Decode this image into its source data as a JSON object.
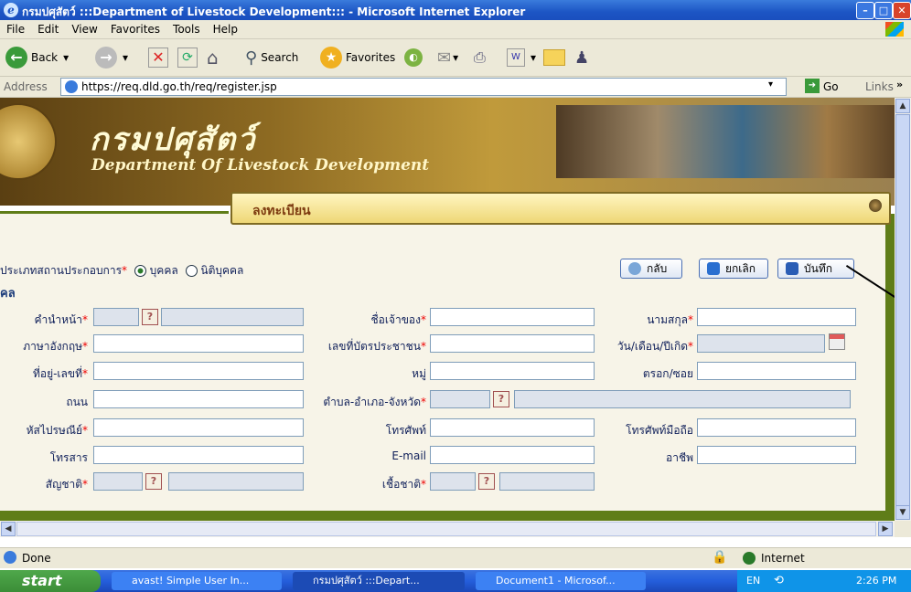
{
  "window": {
    "title": "กรมปศุสัตว์ :::Department of Livestock Development::: - Microsoft Internet Explorer"
  },
  "menu": [
    "File",
    "Edit",
    "View",
    "Favorites",
    "Tools",
    "Help"
  ],
  "toolbar": {
    "back": "Back",
    "search": "Search",
    "favorites": "Favorites"
  },
  "address": {
    "label": "Address",
    "url": "https://req.dld.go.th/req/register.jsp",
    "go": "Go",
    "links": "Links"
  },
  "header": {
    "thai_title": "กรมปศุสัตว์",
    "eng_title": "Department Of Livestock Development"
  },
  "section": {
    "title": "ลงทะเบียน"
  },
  "form": {
    "type_label": "ประเภทสถานประกอบการ",
    "type_opt1": "บุคคล",
    "type_opt2": "นิติบุคคล",
    "sub": "คล",
    "labels": {
      "prefix": "คำนำหน้า",
      "owner": "ชื่อเจ้าของ",
      "surname": "นามสกุล",
      "eng": "ภาษาอังกฤษ",
      "idcard": "เลขที่บัตรประชาชน",
      "dob": "วัน/เดือน/ปีเกิด",
      "address": "ที่อยู่-เลขที่",
      "moo": "หมู่",
      "soi": "ตรอก/ซอย",
      "road": "ถนน",
      "district": "ตำบล-อำเภอ-จังหวัด",
      "postcode": "หัสไปรษณีย์",
      "phone": "โทรศัพท์",
      "mobile": "โทรศัพท์มือถือ",
      "fax": "โทรสาร",
      "email": "E-mail",
      "career": "อาชีพ",
      "nationality": "สัญชาติ",
      "race": "เชื้อชาติ"
    }
  },
  "buttons": {
    "back": "กลับ",
    "cancel": "ยกเลิก",
    "save": "บันทึก"
  },
  "status": {
    "done": "Done",
    "zone": "Internet"
  },
  "taskbar": {
    "start": "start",
    "task1": "avast! Simple User In...",
    "task2": "กรมปศุสัตว์ :::Depart...",
    "task3": "Document1 - Microsof...",
    "lang": "EN",
    "time": "2:26 PM"
  }
}
